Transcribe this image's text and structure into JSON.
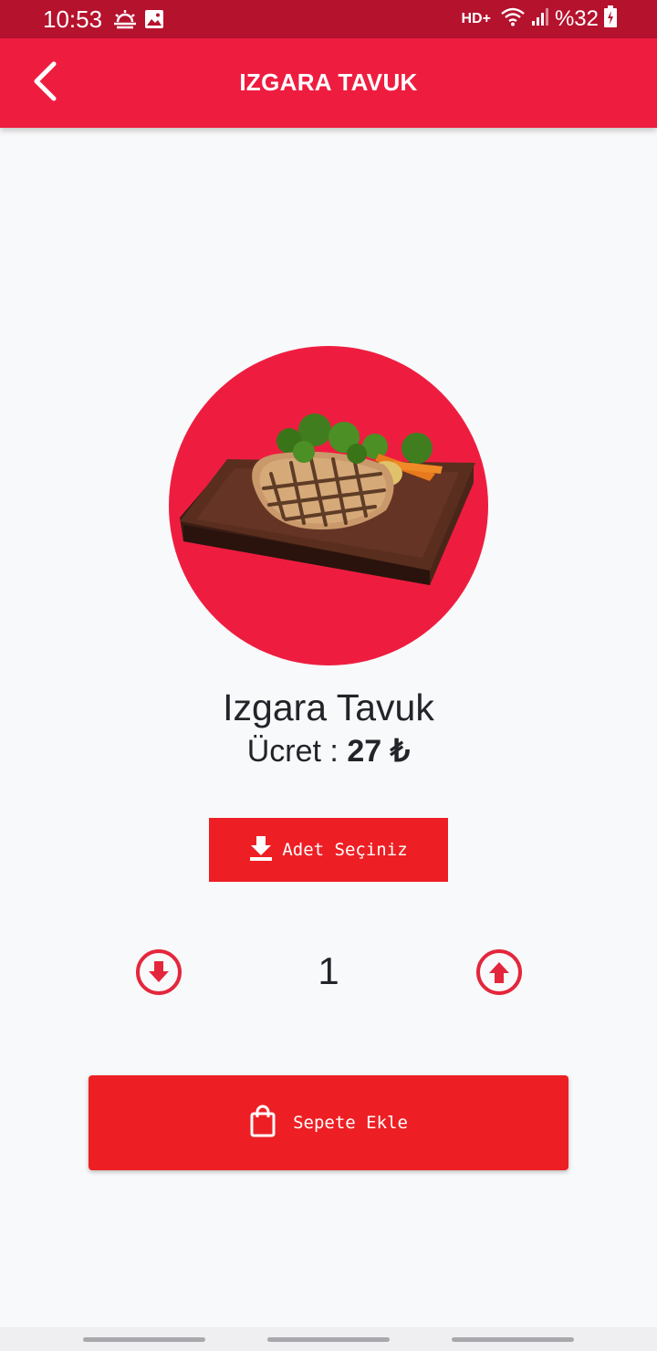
{
  "status_bar": {
    "time": "10:53",
    "network": "HD+",
    "battery": "%32",
    "icons": [
      "weather-icon",
      "image-icon",
      "wifi-icon",
      "signal-icon",
      "battery-charging-icon"
    ]
  },
  "app_bar": {
    "title": "IZGARA TAVUK",
    "back_icon": "chevron-left-icon"
  },
  "product": {
    "image": "grilled-chicken-on-board",
    "name": "Izgara Tavuk",
    "price_label": "Ücret : ",
    "price_value": "27 ₺"
  },
  "quantity_selector": {
    "title_label": "Adet Seçiniz",
    "title_icon": "download-icon",
    "decrease_icon": "arrow-down-circle-icon",
    "increase_icon": "arrow-up-circle-icon",
    "value": "1"
  },
  "cart_button": {
    "label": "Sepete Ekle",
    "icon": "shopping-bag-icon"
  },
  "colors": {
    "status_bar": "#b5122e",
    "primary": "#ee1d40",
    "button": "#ed1f24",
    "background": "#f8f9fa"
  }
}
